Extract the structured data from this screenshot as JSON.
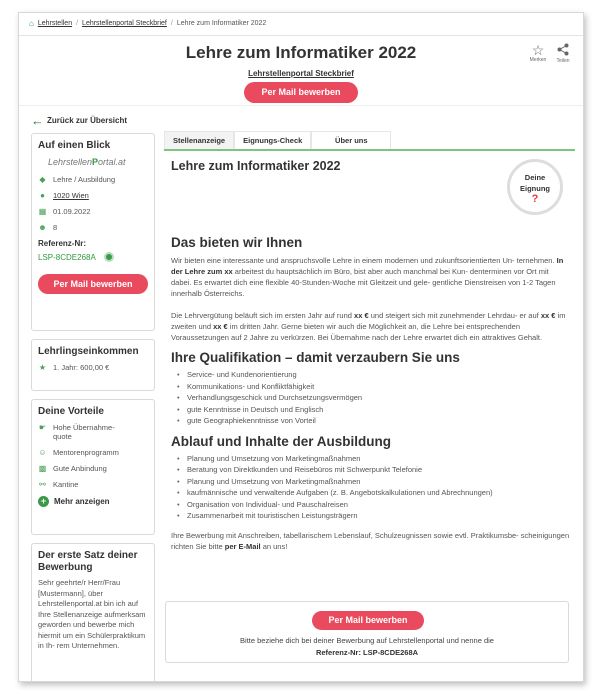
{
  "breadcrumb": [
    "Lehrstellen",
    "Lehrstellenportal Steckbrief",
    "Lehre zum Informatiker 2022"
  ],
  "header": {
    "title": "Lehre zum Informatiker 2022",
    "subtitle": "Lehrstellenportal Steckbrief",
    "apply_label": "Per Mail bewerben",
    "merken": "Merken",
    "teilen": "Teilen"
  },
  "back_label": "Zurück zur Übersicht",
  "overview": {
    "heading": "Auf einen Blick",
    "logo_a": "Lehrstellen",
    "logo_p": "P",
    "logo_b": "ortal.at",
    "type": "Lehre / Ausbildung",
    "location": "1020 Wien",
    "date": "01.09.2022",
    "count": "8",
    "ref_label": "Referenz-Nr:",
    "ref_value": "LSP-8CDE268A",
    "apply_label": "Per Mail bewerben"
  },
  "income": {
    "heading": "Lehrlingseinkommen",
    "value": "1. Jahr: 600,00 €"
  },
  "benefits": {
    "heading": "Deine Vorteile",
    "items": [
      "Hohe Übernahme-\nquote",
      "Mentorenprogramm",
      "Gute Anbindung",
      "Kantine"
    ],
    "more": "Mehr anzeigen"
  },
  "letter": {
    "heading": "Der erste Satz deiner Bewerbung",
    "text": "Sehr geehrte/r Herr/Frau [Mustermann], über Lehrstellenportal.at bin ich auf Ihre Stellenanzeige aufmerksam geworden und bewerbe mich hiermit um ein Schülerpraktikum in Ih- rem Unternehmen."
  },
  "tabs": [
    "Stellenanzeige",
    "Eignungs-Check",
    "Über uns"
  ],
  "main": {
    "title": "Lehre zum Informatiker 2022",
    "eignung_a": "Deine",
    "eignung_b": "Eignung",
    "eignung_q": "?",
    "offer_heading": "Das bieten wir Ihnen",
    "offer_p1_a": "Wir bieten eine interessante und anspruchsvolle Lehre in einem modernen und zukunftsorientierten Un- ternehmen. ",
    "offer_p1_b": "In der Lehre zum xx",
    "offer_p1_c": " arbeitest du hauptsächlich im Büro, bist aber auch manchmal bei Kun- denterminen vor Ort mit dabei. Es erwartet dich eine flexible 40-Stunden-Woche mit Gleitzeit und gele- gentliche Dienstreisen von 1-2 Tagen innerhalb Österreichs.",
    "offer_p2_a": "Die Lehrvergütung beläuft sich im ersten Jahr auf rund ",
    "offer_p2_b": "xx €",
    "offer_p2_c": " und steigert sich mit zunehmender Lehrdau- er auf ",
    "offer_p2_d": "xx €",
    "offer_p2_e": " im zweiten und ",
    "offer_p2_f": "xx €",
    "offer_p2_g": " im dritten Jahr. Gerne bieten wir auch die Möglichkeit an, die Lehre bei entsprechenden Voraussetzungen auf 2 Jahre zu verkürzen. Bei Übernahme nach der Lehre erwartet dich ein attraktives Gehalt.",
    "qual_heading": "Ihre Qualifikation – damit verzaubern Sie uns",
    "qual_items": [
      "Service- und Kundenorientierung",
      "Kommunikations- und Konfliktfähigkeit",
      "Verhandlungsgeschick und Durchsetzungsvermögen",
      "gute Kenntnisse in Deutsch und Englisch",
      "gute Geographiekenntnisse von Vorteil"
    ],
    "flow_heading": "Ablauf und Inhalte der Ausbildung",
    "flow_items": [
      "Planung und Umsetzung von Marketingmaßnahmen",
      "Beratung von Direktkunden und Reisebüros mit Schwerpunkt Telefonie",
      "Planung und Umsetzung von Marketingmaßnahmen",
      "kaufmännische und verwaltende Aufgaben (z. B. Angebotskalkulationen und Abrechnungen)",
      "Organisation von Individual- und Pauschalreisen",
      "Zusammenarbeit mit touristischen Leistungsträgern"
    ],
    "closing_a": "Ihre Bewerbung mit Anschreiben, tabellarischem Lebenslauf, Schulzeugnissen sowie evtl. Praktikumsbe- scheinigungen richten Sie bitte ",
    "closing_b": "per E-Mail",
    "closing_c": " an uns!"
  },
  "apply_box": {
    "button": "Per Mail bewerben",
    "text": "Bitte beziehe dich bei deiner Bewerbung auf Lehrstellenportal und nenne die",
    "ref": "Referenz-Nr: LSP-8CDE268A"
  }
}
